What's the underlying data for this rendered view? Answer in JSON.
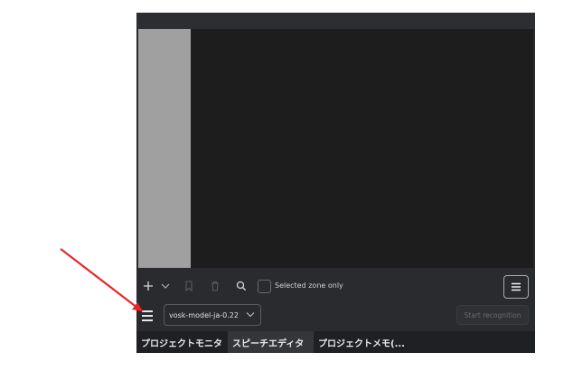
{
  "toolbar": {
    "add_icon": "plus-icon",
    "dropdown_icon": "chevron-down-icon",
    "bookmark_icon": "bookmark-icon",
    "delete_icon": "trash-icon",
    "search_icon": "search-icon",
    "selected_zone_label": "Selected zone only",
    "menu_icon": "hamburger-icon"
  },
  "recognition": {
    "menu_icon": "hamburger-icon",
    "model_value": "vosk-model-ja-0.22",
    "start_label": "Start recognition"
  },
  "tabs": [
    {
      "label": "プロジェクトモニタ",
      "active": false
    },
    {
      "label": "スピーチエディタ",
      "active": true
    },
    {
      "label": "プロジェクトメモ(...",
      "active": false
    }
  ],
  "colors": {
    "annotation_arrow": "#e8262a",
    "panel_bg": "#2a2b2e"
  }
}
